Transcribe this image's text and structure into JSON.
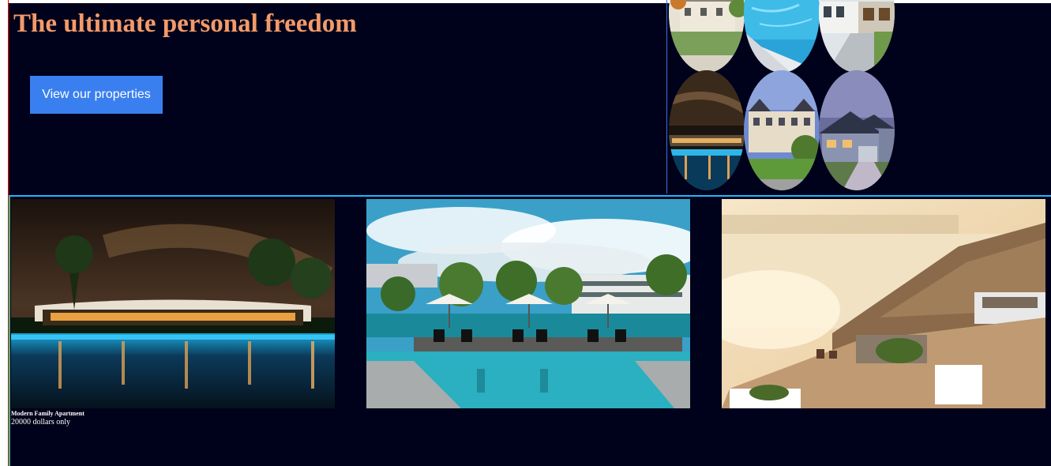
{
  "hero": {
    "title": "The ultimate personal freedom",
    "cta_label": "View our properties",
    "gallery": [
      {
        "photo": "suburban-house-autumn"
      },
      {
        "photo": "pool-corner"
      },
      {
        "photo": "white-villa-driveway"
      },
      {
        "photo": "night-resort-pool"
      },
      {
        "photo": "victorian-mansion"
      },
      {
        "photo": "modern-family-house"
      }
    ]
  },
  "listings": [
    {
      "photo": "resort-pool-night",
      "title": "Modern Family Apartment",
      "price": "20000 dollars only"
    },
    {
      "photo": "hotel-pool-daytime"
    },
    {
      "photo": "cliffside-sunset-terrace"
    }
  ],
  "colors": {
    "background": "#00011a",
    "title": "#f29a6a",
    "button": "#3a7ff0",
    "hero_divider": "#1fb6ff"
  }
}
